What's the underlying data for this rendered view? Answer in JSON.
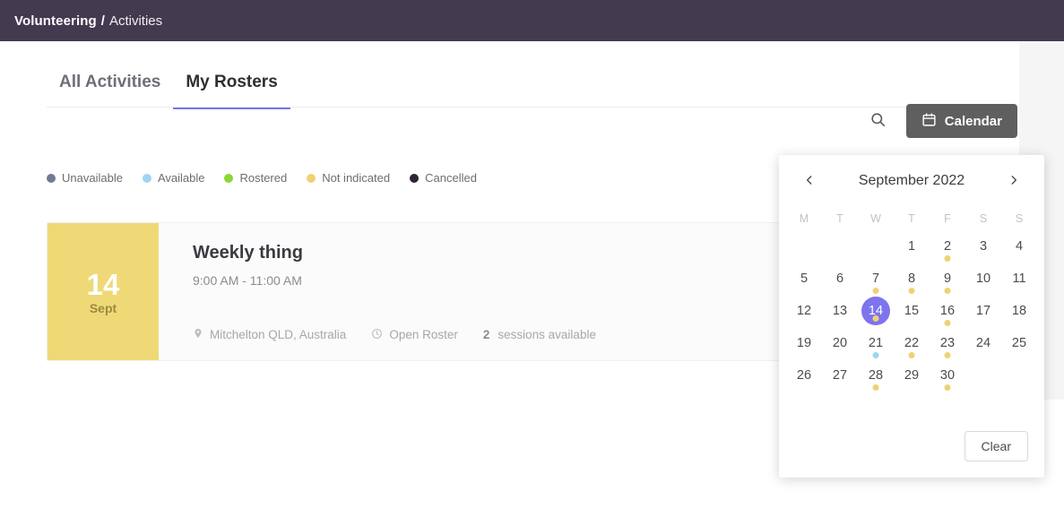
{
  "header": {
    "breadcrumb_primary": "Volunteering",
    "breadcrumb_separator": "/",
    "breadcrumb_secondary": "Activities",
    "bar_color": "#433a50"
  },
  "tabs": [
    {
      "label": "All Activities",
      "active": false
    },
    {
      "label": "My Rosters",
      "active": true
    }
  ],
  "toolbar": {
    "search_icon": "search-icon",
    "calendar_button_label": "Calendar",
    "calendar_button_icon": "calendar-icon",
    "calendar_button_color": "#5f5f5f"
  },
  "legend": [
    {
      "label": "Unavailable",
      "color": "#6d7b93"
    },
    {
      "label": "Available",
      "color": "#9fd4f2"
    },
    {
      "label": "Rostered",
      "color": "#8bd633"
    },
    {
      "label": "Not indicated",
      "color": "#f0d174"
    },
    {
      "label": "Cancelled",
      "color": "#2e2435"
    }
  ],
  "activities": [
    {
      "date_day": "14",
      "date_month": "Sept",
      "date_block_color": "#efd977",
      "title": "Weekly thing",
      "time": "9:00 AM - 11:00 AM",
      "location": "Mitchelton QLD, Australia",
      "location_icon": "map-pin-icon",
      "roster": "Open Roster",
      "roster_icon": "clock-icon",
      "sessions_count": "2",
      "sessions_label": "sessions available"
    }
  ],
  "calendar": {
    "month_label": "September 2022",
    "prev_icon": "chevron-left-icon",
    "next_icon": "chevron-right-icon",
    "weekdays": [
      "M",
      "T",
      "W",
      "T",
      "F",
      "S",
      "S"
    ],
    "selected_day": 14,
    "selected_color": "#7d74ee",
    "lead_blanks": 3,
    "days": [
      {
        "day": 1,
        "marker": null
      },
      {
        "day": 2,
        "marker": "#f0d174"
      },
      {
        "day": 3,
        "marker": null
      },
      {
        "day": 4,
        "marker": null
      },
      {
        "day": 5,
        "marker": null
      },
      {
        "day": 6,
        "marker": null
      },
      {
        "day": 7,
        "marker": "#f0d174"
      },
      {
        "day": 8,
        "marker": "#f0d174"
      },
      {
        "day": 9,
        "marker": "#f0d174"
      },
      {
        "day": 10,
        "marker": null
      },
      {
        "day": 11,
        "marker": null
      },
      {
        "day": 12,
        "marker": null
      },
      {
        "day": 13,
        "marker": null
      },
      {
        "day": 14,
        "marker": "#f0d174"
      },
      {
        "day": 15,
        "marker": null
      },
      {
        "day": 16,
        "marker": "#f0d174"
      },
      {
        "day": 17,
        "marker": null
      },
      {
        "day": 18,
        "marker": null
      },
      {
        "day": 19,
        "marker": null
      },
      {
        "day": 20,
        "marker": null
      },
      {
        "day": 21,
        "marker": "#9fd4f2"
      },
      {
        "day": 22,
        "marker": "#f0d174"
      },
      {
        "day": 23,
        "marker": "#f0d174"
      },
      {
        "day": 24,
        "marker": null
      },
      {
        "day": 25,
        "marker": null
      },
      {
        "day": 26,
        "marker": null
      },
      {
        "day": 27,
        "marker": null
      },
      {
        "day": 28,
        "marker": "#f0d174"
      },
      {
        "day": 29,
        "marker": null
      },
      {
        "day": 30,
        "marker": "#f0d174"
      }
    ],
    "clear_label": "Clear"
  }
}
